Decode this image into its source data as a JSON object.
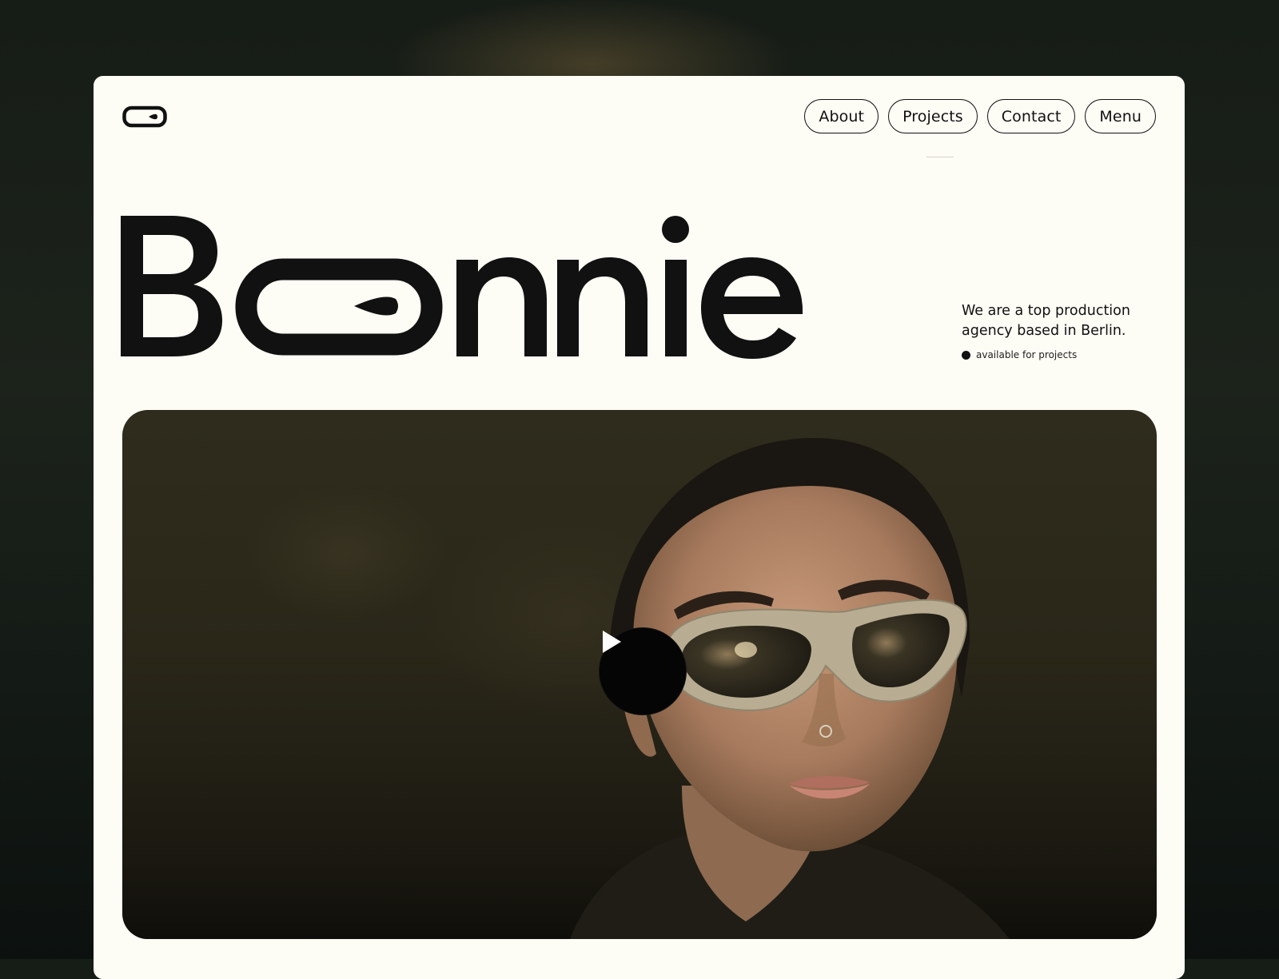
{
  "brand": {
    "wordmark": "Bonnie",
    "logo_icon": "pill-logo-icon"
  },
  "nav": {
    "items": [
      {
        "label": "About"
      },
      {
        "label": "Projects"
      },
      {
        "label": "Contact"
      },
      {
        "label": "Menu"
      }
    ]
  },
  "hero": {
    "tagline": "We are a top production agency based in Berlin.",
    "status": "available for projects",
    "video_play_icon": "play-icon"
  },
  "colors": {
    "page_bg": "#161c16",
    "card_bg": "#fdfcf5",
    "ink": "#111111",
    "play_button": "#050505"
  }
}
